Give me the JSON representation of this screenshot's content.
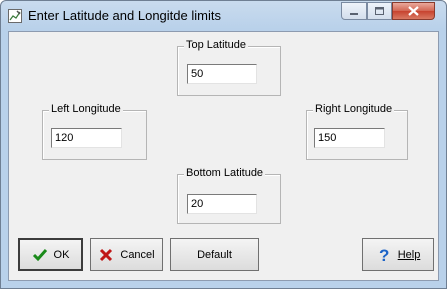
{
  "window": {
    "title": "Enter Latitude and Longitde limits",
    "icons": {
      "app": "pencil-chart-icon",
      "minimize": "minimize-icon",
      "maximize": "maximize-icon",
      "close": "close-icon"
    }
  },
  "fields": {
    "top_latitude": {
      "label": "Top Latitude",
      "value": "50"
    },
    "left_longitude": {
      "label": "Left Longitude",
      "value": "120"
    },
    "right_longitude": {
      "label": "Right Longitude",
      "value": "150"
    },
    "bottom_latitude": {
      "label": "Bottom Latitude",
      "value": "20"
    }
  },
  "buttons": {
    "ok": {
      "label": "OK",
      "icon": "checkmark-icon"
    },
    "cancel": {
      "label": "Cancel",
      "icon": "x-icon"
    },
    "default": {
      "label": "Default"
    },
    "help": {
      "label": "Help",
      "icon": "question-icon"
    }
  },
  "colors": {
    "ok_check": "#1a8a1a",
    "cancel_x": "#c01818",
    "help_q": "#1c63c7",
    "close_button": "#c7432f"
  }
}
